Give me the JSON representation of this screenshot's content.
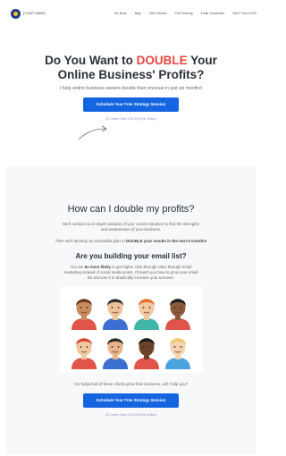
{
  "header": {
    "logo_text": "[YOUR NAME]",
    "nav": [
      "The Book",
      "Blog",
      "Client Stories",
      "Free Training",
      "Email Cheatsheet",
      "See If You're A Fit"
    ]
  },
  "hero": {
    "title_part1": "Do You Want to ",
    "title_accent": "DOUBLE",
    "title_part2": " Your",
    "title_line2": "Online Business' Profits?",
    "subtitle": "I help online business owners double their revenue in just six months!",
    "cta_label": "Schedule Your Free Strategy Session",
    "secondary_link": "Or Learn How I Do It (Free Video)"
  },
  "section": {
    "heading": "How can I double my profits?",
    "para1": "We'll conduct an in-depth analysis of your current situation to find the strengths and weaknesses of your business.",
    "para2_pre": "Then we'll develop an actionable plan to ",
    "para2_bold": "DOUBLE your results in the next 6 months!",
    "subheading": "Are you building your email list?",
    "para3_pre": "You are ",
    "para3_bold": "6x more likely",
    "para3_post": " to get higher click-through rates through email marketing instead of social media posts. I'll teach you how to grow your email list and use it to drastically increase your turnover.",
    "clients_text": "I've helped all of these clients grow their business, will I help you?",
    "cta_label": "Schedule Your Free Strategy Session",
    "secondary_link": "Or Learn How I Do It (Free Video)"
  },
  "illustration": {
    "faces": [
      {
        "name": "face-1",
        "skin": "#c98a5e",
        "hair": "#6b3a1f",
        "shirt": "#e1544a"
      },
      {
        "name": "face-2",
        "skin": "#f0c29a",
        "hair": "#2d2d2d",
        "shirt": "#3b6fd1"
      },
      {
        "name": "face-3",
        "skin": "#f2c8a0",
        "hair": "#e8702a",
        "shirt": "#3fb6a8"
      },
      {
        "name": "face-4",
        "skin": "#8a5a3a",
        "hair": "#1e1e1e",
        "shirt": "#e1544a"
      },
      {
        "name": "face-5",
        "skin": "#f2c8a0",
        "hair": "#d9442f",
        "shirt": "#e1544a"
      },
      {
        "name": "face-6",
        "skin": "#e8b48a",
        "hair": "#2d2d2d",
        "shirt": "#3b6fd1"
      },
      {
        "name": "face-7",
        "skin": "#6e4228",
        "hair": "#1e1e1e",
        "shirt": "#e1544a"
      },
      {
        "name": "face-8",
        "skin": "#f5d2b0",
        "hair": "#e9c96a",
        "shirt": "#4aa3df"
      }
    ]
  },
  "colors": {
    "accent": "#e8453c",
    "button": "#1565e0",
    "link": "#8a7fc4",
    "section_bg": "#f6f8fa"
  }
}
